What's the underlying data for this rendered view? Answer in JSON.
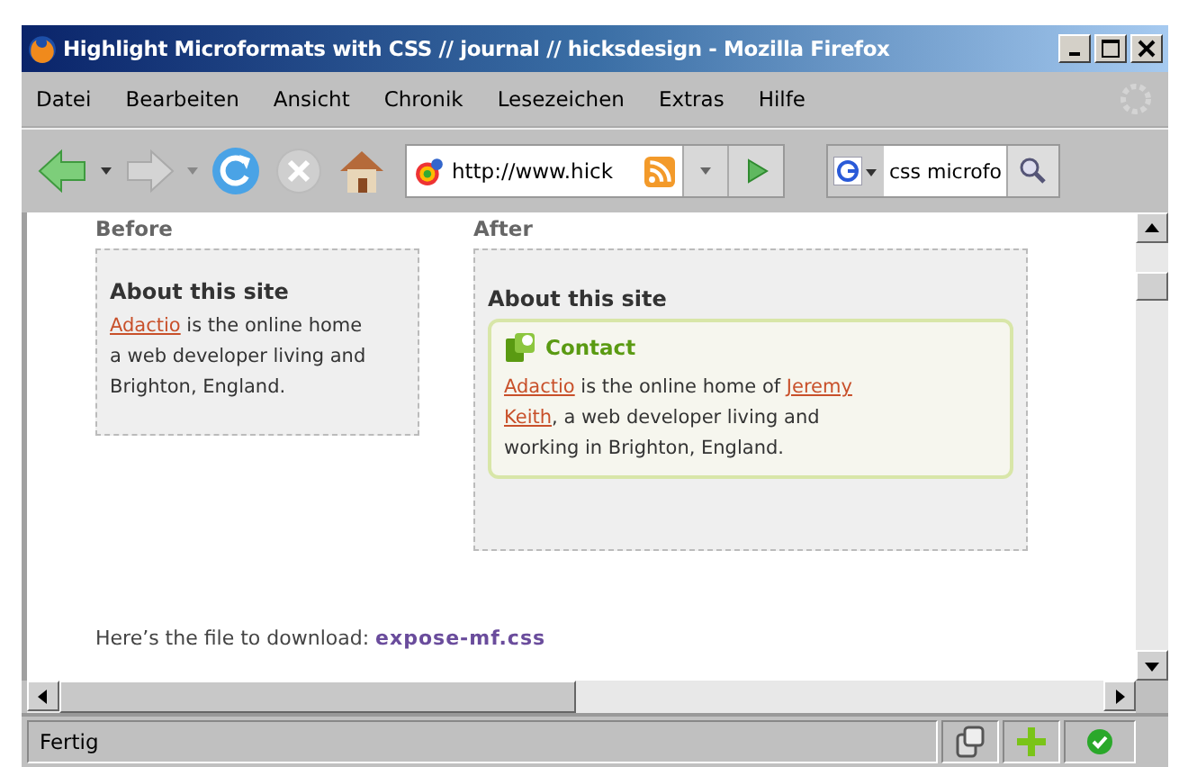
{
  "window": {
    "title": "Highlight Microformats with CSS // journal // hicksdesign - Mozilla Firefox"
  },
  "menu": [
    "Datei",
    "Bearbeiten",
    "Ansicht",
    "Chronik",
    "Lesezeichen",
    "Extras",
    "Hilfe"
  ],
  "toolbar": {
    "url": "http://www.hick",
    "search": "css microfo"
  },
  "before": {
    "heading": "Before",
    "title": "About this site",
    "lines": [
      [
        {
          "text": "Adactio",
          "link": true
        },
        {
          "text": " is the online home",
          "link": false
        }
      ],
      [
        {
          "text": "a web developer living and",
          "link": false
        }
      ],
      [
        {
          "text": "Brighton, England.",
          "link": false
        }
      ]
    ]
  },
  "after": {
    "heading": "After",
    "title": "About this site",
    "card_title": "Contact",
    "lines": [
      [
        {
          "text": "Adactio",
          "link": true
        },
        {
          "text": " is the online home of ",
          "link": false
        },
        {
          "text": "Jeremy",
          "link": true
        }
      ],
      [
        {
          "text": "Keith",
          "link": true
        },
        {
          "text": ", a web developer living and",
          "link": false
        }
      ],
      [
        {
          "text": "working in Brighton, England.",
          "link": false
        }
      ]
    ]
  },
  "download": {
    "text": "Here’s the file to download:",
    "link": "expose-mf.css"
  },
  "status_bar": {
    "text": "Fertig"
  }
}
